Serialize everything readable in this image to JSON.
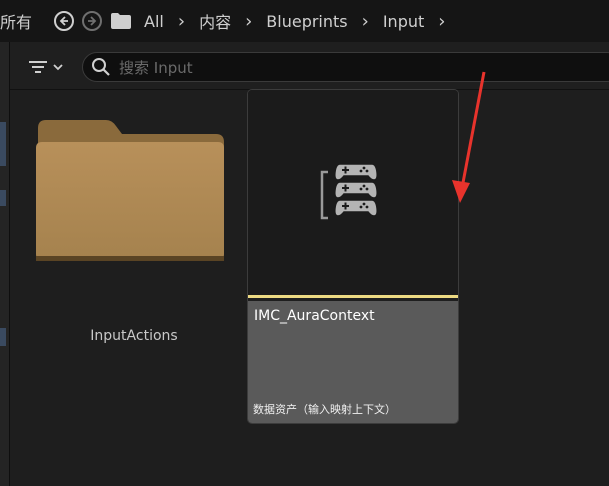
{
  "pathbar": {
    "all_label": "所有",
    "crumbs": [
      "All",
      "内容",
      "Blueprints",
      "Input"
    ]
  },
  "toolbar": {
    "search_placeholder": "搜索 Input"
  },
  "assets": {
    "folder": {
      "name": "InputActions"
    },
    "item": {
      "name": "IMC_AuraContext",
      "type": "数据资产（输入映射上下文）"
    }
  },
  "colors": {
    "folder": "#b08a52",
    "selection_bar": "#ecd982",
    "annotation_arrow": "#e8332c"
  }
}
